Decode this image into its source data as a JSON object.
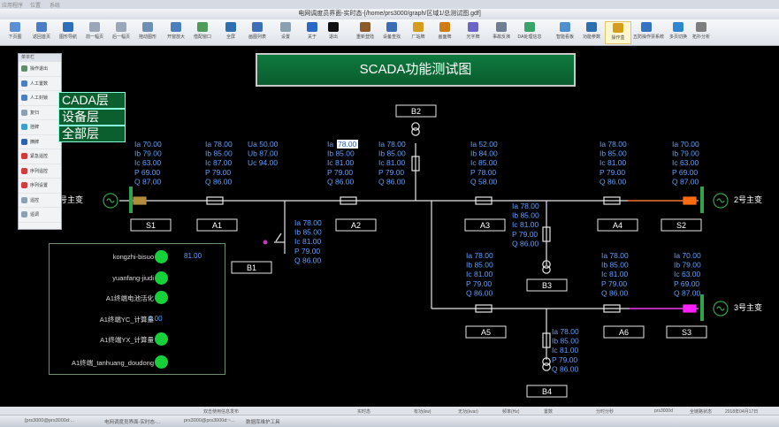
{
  "window": {
    "title": "电网调度员界面-实时态-[/home/prs3000/graph/区域1/总测试图.gdf]"
  },
  "toolbar": [
    {
      "label": "下页图",
      "icon": "page-icon"
    },
    {
      "label": "返回首页",
      "icon": "home-icon"
    },
    {
      "label": "图形导航",
      "icon": "nav-icon"
    },
    {
      "label": "前一幅页",
      "icon": "back-icon"
    },
    {
      "label": "后一幅页",
      "icon": "forward-icon"
    },
    {
      "label": "拖动图形",
      "icon": "move-icon"
    },
    {
      "label": "开窗放大",
      "icon": "zoom-icon"
    },
    {
      "label": "借配窗口",
      "icon": "window-icon"
    },
    {
      "label": "全屏",
      "icon": "fullscreen-icon"
    },
    {
      "label": "画图列表",
      "icon": "list-icon"
    },
    {
      "label": "设置",
      "icon": "settings-icon"
    },
    {
      "label": "关于",
      "icon": "info-icon"
    },
    {
      "label": "退出",
      "icon": "exit-icon"
    },
    {
      "label": "重新登陆",
      "icon": "login-icon"
    },
    {
      "label": "设备查找",
      "icon": "device-icon"
    },
    {
      "label": "厂站牌",
      "icon": "station-icon"
    },
    {
      "label": "画面牌",
      "icon": "screen-icon"
    },
    {
      "label": "光字牌",
      "icon": "light-icon"
    },
    {
      "label": "事故反演",
      "icon": "replay-icon"
    },
    {
      "label": "DA处理信息",
      "icon": "da-icon"
    },
    {
      "label": "智能看板",
      "icon": "board-icon"
    },
    {
      "label": "功能参数",
      "icon": "param-icon"
    },
    {
      "label": "操作盒",
      "icon": "op-icon"
    },
    {
      "label": "五防操作票系统",
      "icon": "ticket-icon"
    },
    {
      "label": "多页切换",
      "icon": "multipage-icon"
    },
    {
      "label": "拓扑分析",
      "icon": "topology-icon"
    }
  ],
  "sidepanel": {
    "header": "菜单栏",
    "items": [
      "操作退出",
      "人工置数",
      "人工封锁",
      "复归",
      "挂牌",
      "摘牌",
      "紧急遥控",
      "序列遥控",
      "序列设置",
      "遥控",
      "遥调"
    ]
  },
  "diagram": {
    "title": "SCADA功能测试图",
    "layers": [
      "CADA层",
      "设备层",
      "全部层"
    ],
    "transformers": [
      "1号主变",
      "2号主变",
      "3号主变"
    ],
    "buses": [
      "S1",
      "A1",
      "A2",
      "A3",
      "A4",
      "S2",
      "B1",
      "B2",
      "B3",
      "B4",
      "A5",
      "A6",
      "S3"
    ],
    "meas_blocks": [
      {
        "lines": [
          "Ia 70.00",
          "Ib 79.00",
          "Ic 63.00",
          "P  69.00",
          "Q  87.00"
        ]
      },
      {
        "lines": [
          "Ia  78.00",
          "Ib  85.00",
          "Ic  87.00",
          "P  79.00",
          "Q  86.00"
        ]
      },
      {
        "lines": [
          "Ua 50.00",
          "Ub 87.00",
          "Uc 94.00"
        ]
      },
      {
        "lines": [
          "Ia",
          "Ib  85.00",
          "Ic  81.00",
          "P  79.00",
          "Q  86.00"
        ],
        "highlight": "78.00"
      },
      {
        "lines": [
          "Ia  78.00",
          "Ib  85.00",
          "Ic  81.00",
          "P  79.00",
          "Q  86.00"
        ]
      },
      {
        "lines": [
          "Ia  52.00",
          "Ib  84.00",
          "Ic  85.00",
          "P  78.00",
          "Q  58.00"
        ]
      },
      {
        "lines": [
          "Ia  78.00",
          "Ib  85.00",
          "Ic  81.00",
          "P  79.00",
          "Q  86.00"
        ]
      },
      {
        "lines": [
          "Ia  70.00",
          "Ib  79.00",
          "Ic  63.00",
          "P  69.00",
          "Q  87.00"
        ]
      },
      {
        "lines": [
          "Ia  78.00",
          "Ib  85.00",
          "Ic  81.00",
          "P  79.00",
          "Q  86.00"
        ]
      },
      {
        "lines": [
          "Ia  78.00",
          "Ib  85.00",
          "Ic  81.00",
          "P  79.00",
          "Q  86.00"
        ]
      },
      {
        "lines": [
          "Ia  78.00",
          "Ib  85.00",
          "Ic  81.00",
          "P  79.00",
          "Q  86.00"
        ]
      },
      {
        "lines": [
          "Ia  78.00",
          "Ib  85.00",
          "Ic  81.00",
          "P  79.00",
          "Q  86.00"
        ]
      },
      {
        "lines": [
          "Ia  70.00",
          "Ib  79.00",
          "Ic  63.00",
          "P  69.00",
          "Q  87.00"
        ]
      },
      {
        "lines": [
          "Ia  78.00",
          "Ib  85.00",
          "Ic  81.00",
          "P  79.00",
          "Q  86.00"
        ]
      }
    ]
  },
  "status_panel": {
    "rows": [
      {
        "label": "kongzhi-bisuo",
        "state": "on"
      },
      {
        "label": "yuanfang-jiudi",
        "state": "on"
      },
      {
        "label": "A1终端电池活化",
        "state": "on"
      },
      {
        "label": "A1终端YC_计算量",
        "value": "0.00"
      },
      {
        "label": "A1终端YX_计算量",
        "state": "on"
      },
      {
        "label": "A1终端_tanhuang_doudong",
        "state": "on"
      }
    ],
    "extra_value": "81.00"
  },
  "statusbar": [
    "双击使用信息发布",
    "实时态",
    "有功(kw)",
    "无功(kvar)",
    "频率(Hz)",
    "置数",
    "分时分秒",
    "prs3000d",
    "全链路状态",
    "2018年04月17日"
  ],
  "taskbar": [
    "[prs3000@prs3000d:...",
    "电网调度员界面-实时态-...",
    "prs3000@prs3000d:~...",
    "数据库维护工具"
  ],
  "colors": {
    "led_on": "#17d13b",
    "measure_text": "#5aa0ff",
    "line": "#e6e6e6",
    "s2_breaker": "#ff6a13",
    "s3_breaker": "#ff20ff"
  }
}
